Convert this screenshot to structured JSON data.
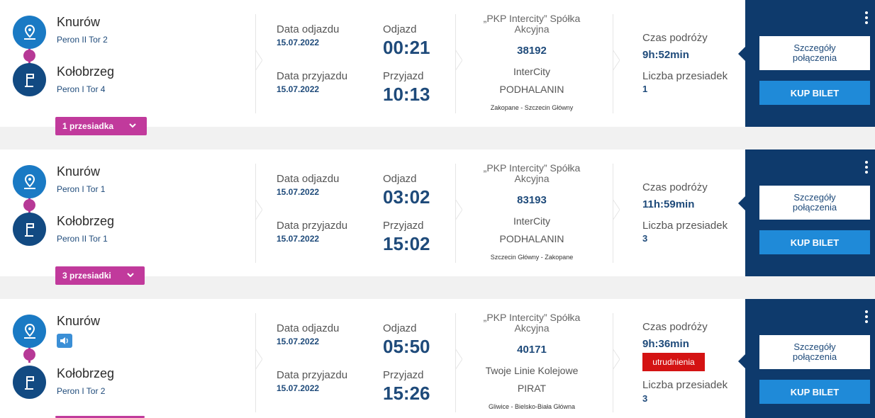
{
  "results": [
    {
      "from": {
        "name": "Knurów",
        "platform": "Peron II Tor 2"
      },
      "to": {
        "name": "Kołobrzeg",
        "platform": "Peron I Tor 4"
      },
      "transfers_label": "1 przesiadka",
      "departure_date_label": "Data odjazdu",
      "departure_date": "15.07.2022",
      "arrival_date_label": "Data przyjazdu",
      "arrival_date": "15.07.2022",
      "departure_label": "Odjazd",
      "departure_time": "00:21",
      "arrival_label": "Przyjazd",
      "arrival_time": "10:13",
      "carrier_line1": "„PKP Intercity” Spółka",
      "carrier_line2": "Akcyjna",
      "train_number": "38192",
      "brand": "InterCity",
      "train_name": "PODHALANIN",
      "relation": "Zakopane - Szczecin Główny",
      "duration_label": "Czas podróży",
      "duration": "9h:52min",
      "transfers_count_label": "Liczba przesiadek",
      "transfers_count": "1",
      "details_line1": "Szczegóły",
      "details_line2": "połączenia",
      "buy_label": "KUP BILET"
    },
    {
      "from": {
        "name": "Knurów",
        "platform": "Peron I Tor 1"
      },
      "to": {
        "name": "Kołobrzeg",
        "platform": "Peron II Tor 1"
      },
      "transfers_label": "3 przesiadki",
      "departure_date_label": "Data odjazdu",
      "departure_date": "15.07.2022",
      "arrival_date_label": "Data przyjazdu",
      "arrival_date": "15.07.2022",
      "departure_label": "Odjazd",
      "departure_time": "03:02",
      "arrival_label": "Przyjazd",
      "arrival_time": "15:02",
      "carrier_line1": "„PKP Intercity” Spółka",
      "carrier_line2": "Akcyjna",
      "train_number": "83193",
      "brand": "InterCity",
      "train_name": "PODHALANIN",
      "relation": "Szczecin Główny - Zakopane",
      "duration_label": "Czas podróży",
      "duration": "11h:59min",
      "transfers_count_label": "Liczba przesiadek",
      "transfers_count": "3",
      "details_line1": "Szczegóły",
      "details_line2": "połączenia",
      "buy_label": "KUP BILET"
    },
    {
      "from": {
        "name": "Knurów",
        "platform": ""
      },
      "to": {
        "name": "Kołobrzeg",
        "platform": "Peron I Tor 2"
      },
      "transfers_label": "",
      "departure_date_label": "Data odjazdu",
      "departure_date": "15.07.2022",
      "arrival_date_label": "Data przyjazdu",
      "arrival_date": "15.07.2022",
      "departure_label": "Odjazd",
      "departure_time": "05:50",
      "arrival_label": "Przyjazd",
      "arrival_time": "15:26",
      "carrier_line1": "„PKP Intercity” Spółka",
      "carrier_line2": "Akcyjna",
      "train_number": "40171",
      "brand": "Twoje Linie Kolejowe",
      "train_name": "PIRAT",
      "relation": "Gliwice - Bielsko-Biała Główna",
      "duration_label": "Czas podróży",
      "duration": "9h:36min",
      "warning": "utrudnienia",
      "transfers_count_label": "Liczba przesiadek",
      "transfers_count": "3",
      "details_line1": "Szczegóły",
      "details_line2": "połączenia",
      "buy_label": "KUP BILET"
    }
  ],
  "colors": {
    "accent_blue": "#1e4a7a",
    "panel": "#0e3a6c",
    "transfer_pink": "#c13a9c",
    "warning_red": "#d41313"
  }
}
